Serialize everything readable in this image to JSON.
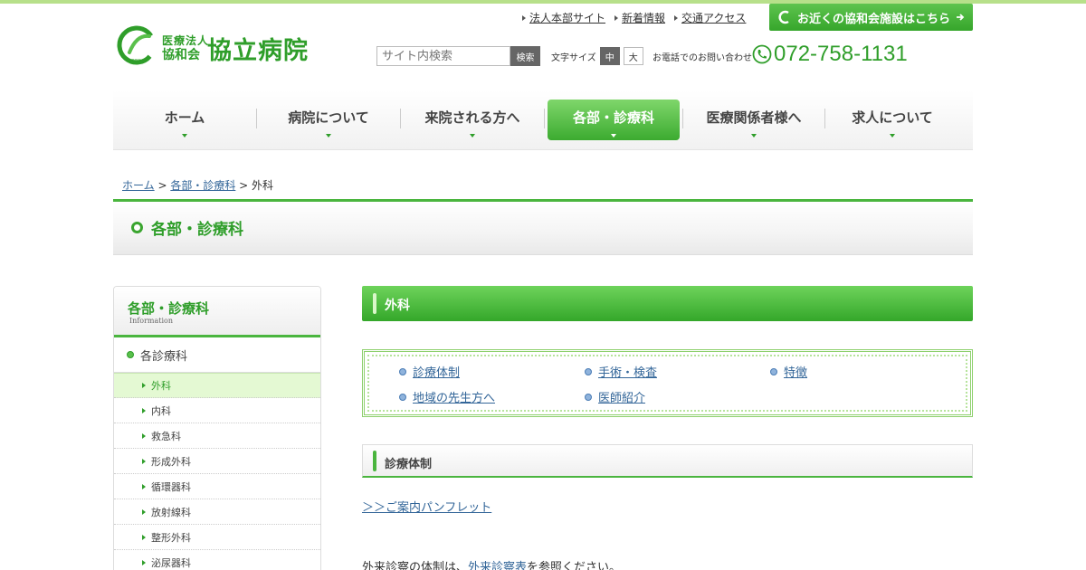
{
  "header": {
    "logo_small": "医療法人",
    "logo_sub": "協和会",
    "logo_big": "協立病院",
    "logo_mark": "kyowa",
    "toplinks": [
      "法人本部サイト",
      "新着情報",
      "交通アクセス"
    ],
    "near_button": "お近くの協和会施設はこちら",
    "search_placeholder": "サイト内検索",
    "search_button": "検索",
    "fontsize_label": "文字サイズ",
    "fontsize_medium": "中",
    "fontsize_large": "大",
    "phone_label": "お電話でのお問い合わせ",
    "phone_number": "072-758-1131"
  },
  "nav": {
    "items": [
      "ホーム",
      "病院について",
      "来院される方へ",
      "各部・診療科",
      "医療関係者様へ",
      "求人について"
    ],
    "active": "各部・診療科"
  },
  "breadcrumb": {
    "home": "ホーム",
    "sep1": " > ",
    "dept": "各部・診療科",
    "sep2": " > ",
    "current": "外科"
  },
  "page_title": "各部・診療科",
  "sidebar": {
    "title": "各部・診療科",
    "subtitle": "Information",
    "category": "各診療科",
    "items": [
      "外科",
      "内科",
      "救急科",
      "形成外科",
      "循環器科",
      "放射線科",
      "整形外科",
      "泌尿器科"
    ],
    "active_item": "外科"
  },
  "main": {
    "section_title": "外科",
    "anchors": [
      "診療体制",
      "手術・検査",
      "特徴",
      "地域の先生方へ",
      "医師紹介"
    ],
    "subsection_title": "診療体制",
    "pamphlet_link": "＞＞ご案内パンフレット",
    "body_prefix": "外来診察の体制は、",
    "body_link": "外来診察表",
    "body_suffix": "を参照ください。"
  },
  "colors": {
    "brand_green": "#2f9e2a",
    "link_blue": "#336699",
    "active_bg": "#e4f9d3"
  }
}
